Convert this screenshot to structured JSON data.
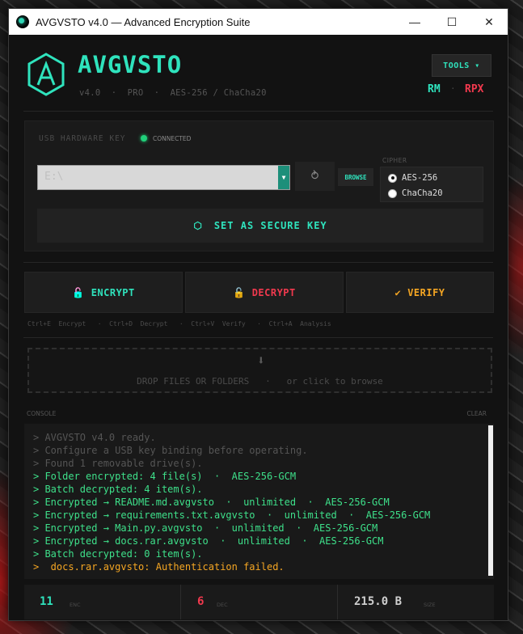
{
  "window": {
    "title": "AVGVSTO v4.0  —  Advanced Encryption Suite"
  },
  "header": {
    "brand": "AVGVSTO",
    "subtitle": "v4.0  ·  PRO  ·  AES-256 / ChaCha20",
    "tools_label": "TOOLS ▾",
    "mode_rm": "RM",
    "mode_sep": "·",
    "mode_rpx": "RPX"
  },
  "usb": {
    "label": "USB HARDWARE KEY",
    "status": "CONNECTED",
    "drive_value": "E:\\",
    "refresh_icon": "⥁",
    "browse_label": "BROWSE",
    "cipher_label": "CIPHER",
    "cipher_options": [
      "AES-256",
      "ChaCha20"
    ],
    "cipher_selected": "AES-256",
    "secure_icon": "⬡",
    "secure_label": "SET AS SECURE KEY"
  },
  "actions": {
    "encrypt": {
      "icon": "🔓",
      "label": "ENCRYPT",
      "color": "#2fe3bd"
    },
    "decrypt": {
      "icon": "🔓",
      "label": "DECRYPT",
      "color": "#f2394e"
    },
    "verify": {
      "icon": "✔",
      "label": "VERIFY",
      "color": "#f5a623"
    },
    "shortcuts": "Ctrl+E  Encrypt   ·  Ctrl+D  Decrypt   ·  Ctrl+V  Verify   ·  Ctrl+A  Analysis"
  },
  "dropzone": {
    "icon": "⬇",
    "text": "DROP FILES OR FOLDERS   ·   or click to browse"
  },
  "console": {
    "title": "CONSOLE",
    "clear_label": "CLEAR",
    "lines": [
      {
        "text": "> AVGVSTO v4.0 ready.",
        "color": "#555555"
      },
      {
        "text": "> Configure a USB key binding before operating.",
        "color": "#555555"
      },
      {
        "text": "> Found 1 removable drive(s).",
        "color": "#555555"
      },
      {
        "text": "> Folder encrypted: 4 file(s)  ·  AES-256-GCM",
        "color": "#3ee08a"
      },
      {
        "text": "> Batch decrypted: 4 item(s).",
        "color": "#3ee08a"
      },
      {
        "text": "> Encrypted → README.md.avgvsto  ·  unlimited  ·  AES-256-GCM",
        "color": "#3ee08a"
      },
      {
        "text": "> Encrypted → requirements.txt.avgvsto  ·  unlimited  ·  AES-256-GCM",
        "color": "#3ee08a"
      },
      {
        "text": "> Encrypted → Main.py.avgvsto  ·  unlimited  ·  AES-256-GCM",
        "color": "#3ee08a"
      },
      {
        "text": "> Encrypted → docs.rar.avgvsto  ·  unlimited  ·  AES-256-GCM",
        "color": "#3ee08a"
      },
      {
        "text": "> Batch decrypted: 0 item(s).",
        "color": "#3ee08a"
      },
      {
        "text": ">  docs.rar.avgvsto: Authentication failed.",
        "color": "#f5a623"
      }
    ]
  },
  "stats": [
    {
      "value": "11",
      "label": "ENC",
      "color": "#2fe3bd"
    },
    {
      "value": "6",
      "label": "DEC",
      "color": "#f2394e"
    },
    {
      "value": "215.0 B",
      "label": "SIZE",
      "color": "#cfcfcf"
    }
  ]
}
